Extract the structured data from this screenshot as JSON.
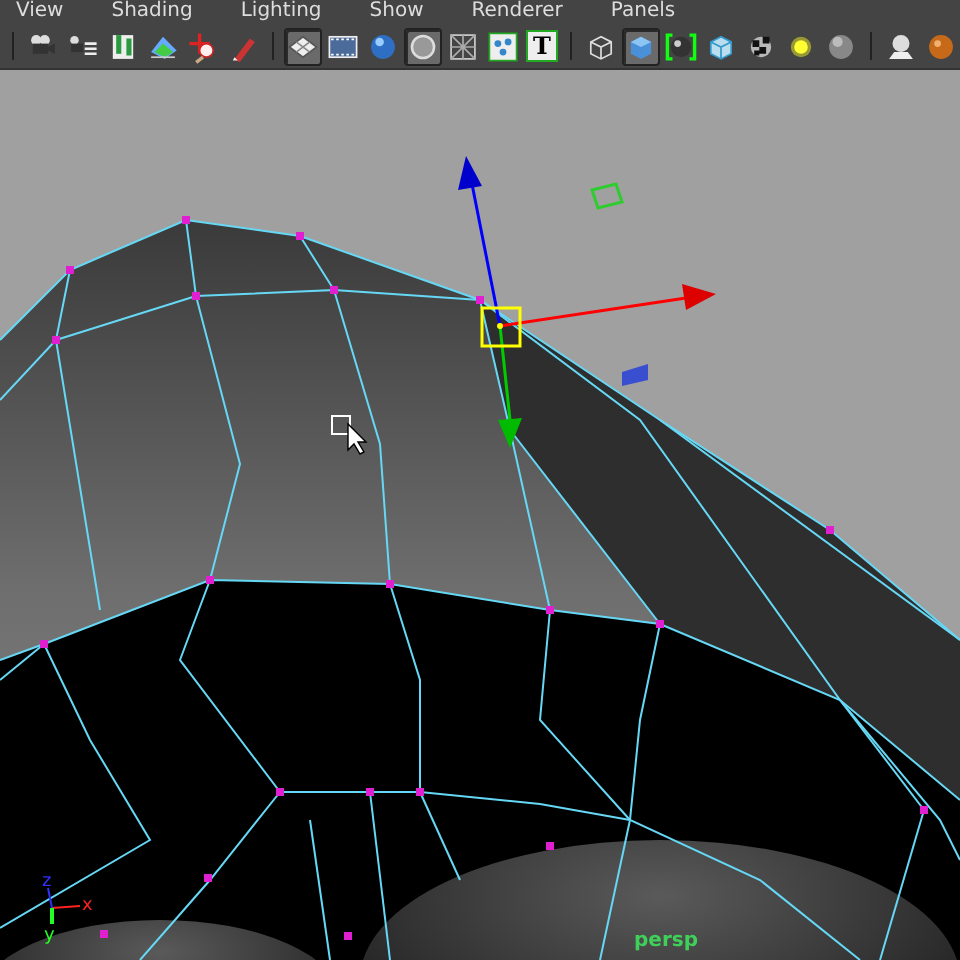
{
  "menu": [
    "View",
    "Shading",
    "Lighting",
    "Show",
    "Renderer",
    "Panels"
  ],
  "toolbar": [
    [
      {
        "kind": "camera",
        "on": false
      },
      {
        "kind": "camera-list",
        "on": false
      },
      {
        "kind": "bookmark",
        "on": false
      },
      {
        "kind": "image",
        "on": false
      },
      {
        "kind": "target",
        "on": false
      },
      {
        "kind": "pen",
        "on": false
      }
    ],
    [
      {
        "kind": "grid",
        "on": true
      },
      {
        "kind": "film",
        "on": false
      },
      {
        "kind": "sphere",
        "on": false
      },
      {
        "kind": "ring",
        "on": true
      },
      {
        "kind": "wire",
        "on": false
      },
      {
        "kind": "dots",
        "on": false
      },
      {
        "kind": "text",
        "on": false,
        "label": "T"
      }
    ],
    [
      {
        "kind": "wirecube",
        "on": false
      },
      {
        "kind": "cube",
        "on": true
      },
      {
        "kind": "xray",
        "on": false
      },
      {
        "kind": "glasscube",
        "on": false
      },
      {
        "kind": "checker",
        "on": false
      },
      {
        "kind": "light",
        "on": false
      },
      {
        "kind": "ball",
        "on": false
      }
    ],
    [
      {
        "kind": "stand",
        "on": false
      },
      {
        "kind": "orange",
        "on": false
      }
    ]
  ],
  "viewport": {
    "axes": {
      "x": "x",
      "y": "y",
      "z": "z"
    },
    "camera": "persp"
  }
}
